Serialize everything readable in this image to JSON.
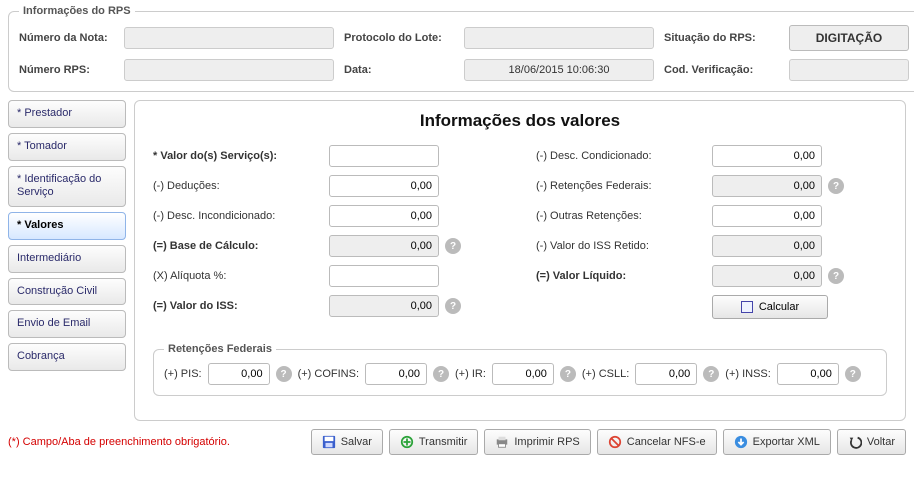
{
  "rps": {
    "legend": "Informações do RPS",
    "labels": {
      "numero_nota": "Número da Nota:",
      "protocolo_lote": "Protocolo do Lote:",
      "situacao_rps": "Situação do RPS:",
      "numero_rps": "Número RPS:",
      "data": "Data:",
      "cod_verificacao": "Cod. Verificação:"
    },
    "values": {
      "numero_nota": "",
      "protocolo_lote": "",
      "situacao": "DIGITAÇÃO",
      "numero_rps": "",
      "data": "18/06/2015 10:06:30",
      "cod_verificacao": ""
    }
  },
  "tabs": [
    {
      "id": "prestador",
      "label": "* Prestador"
    },
    {
      "id": "tomador",
      "label": "* Tomador"
    },
    {
      "id": "id-servico",
      "label": "* Identificação do Serviço"
    },
    {
      "id": "valores",
      "label": "* Valores"
    },
    {
      "id": "intermediario",
      "label": "Intermediário"
    },
    {
      "id": "civil",
      "label": "Construção Civil"
    },
    {
      "id": "email",
      "label": "Envio de Email"
    },
    {
      "id": "cobranca",
      "label": "Cobrança"
    }
  ],
  "active_tab": "valores",
  "panel": {
    "title": "Informações dos valores",
    "left": [
      {
        "label": "* Valor do(s) Serviço(s):",
        "value": "",
        "readonly": false,
        "help": false,
        "bold": true
      },
      {
        "label": "(-) Deduções:",
        "value": "0,00",
        "readonly": false,
        "help": false,
        "bold": false
      },
      {
        "label": "(-) Desc. Incondicionado:",
        "value": "0,00",
        "readonly": false,
        "help": false,
        "bold": false
      },
      {
        "label": "(=) Base de Cálculo:",
        "value": "0,00",
        "readonly": true,
        "help": true,
        "bold": true
      },
      {
        "label": "(X) Alíquota %:",
        "value": "",
        "readonly": false,
        "help": false,
        "bold": false
      },
      {
        "label": "(=) Valor do ISS:",
        "value": "0,00",
        "readonly": true,
        "help": true,
        "bold": true
      }
    ],
    "right": [
      {
        "label": "(-) Desc. Condicionado:",
        "value": "0,00",
        "readonly": false,
        "help": false,
        "bold": false
      },
      {
        "label": "(-) Retenções Federais:",
        "value": "0,00",
        "readonly": true,
        "help": true,
        "bold": false
      },
      {
        "label": "(-) Outras Retenções:",
        "value": "0,00",
        "readonly": false,
        "help": false,
        "bold": false
      },
      {
        "label": "(-) Valor do ISS Retido:",
        "value": "0,00",
        "readonly": true,
        "help": false,
        "bold": false
      },
      {
        "label": "(=) Valor Líquido:",
        "value": "0,00",
        "readonly": true,
        "help": true,
        "bold": true
      }
    ],
    "calcular_label": "Calcular",
    "ret_legend": "Retenções Federais",
    "ret": [
      {
        "label": "(+) PIS:",
        "value": "0,00"
      },
      {
        "label": "(+) COFINS:",
        "value": "0,00"
      },
      {
        "label": "(+) IR:",
        "value": "0,00"
      },
      {
        "label": "(+) CSLL:",
        "value": "0,00"
      },
      {
        "label": "(+) INSS:",
        "value": "0,00"
      }
    ]
  },
  "footer": {
    "required_text": "(*) Campo/Aba de preenchimento obrigatório.",
    "buttons": {
      "salvar": "Salvar",
      "transmitir": "Transmitir",
      "imprimir": "Imprimir RPS",
      "cancelar": "Cancelar NFS-e",
      "exportar": "Exportar XML",
      "voltar": "Voltar"
    }
  }
}
